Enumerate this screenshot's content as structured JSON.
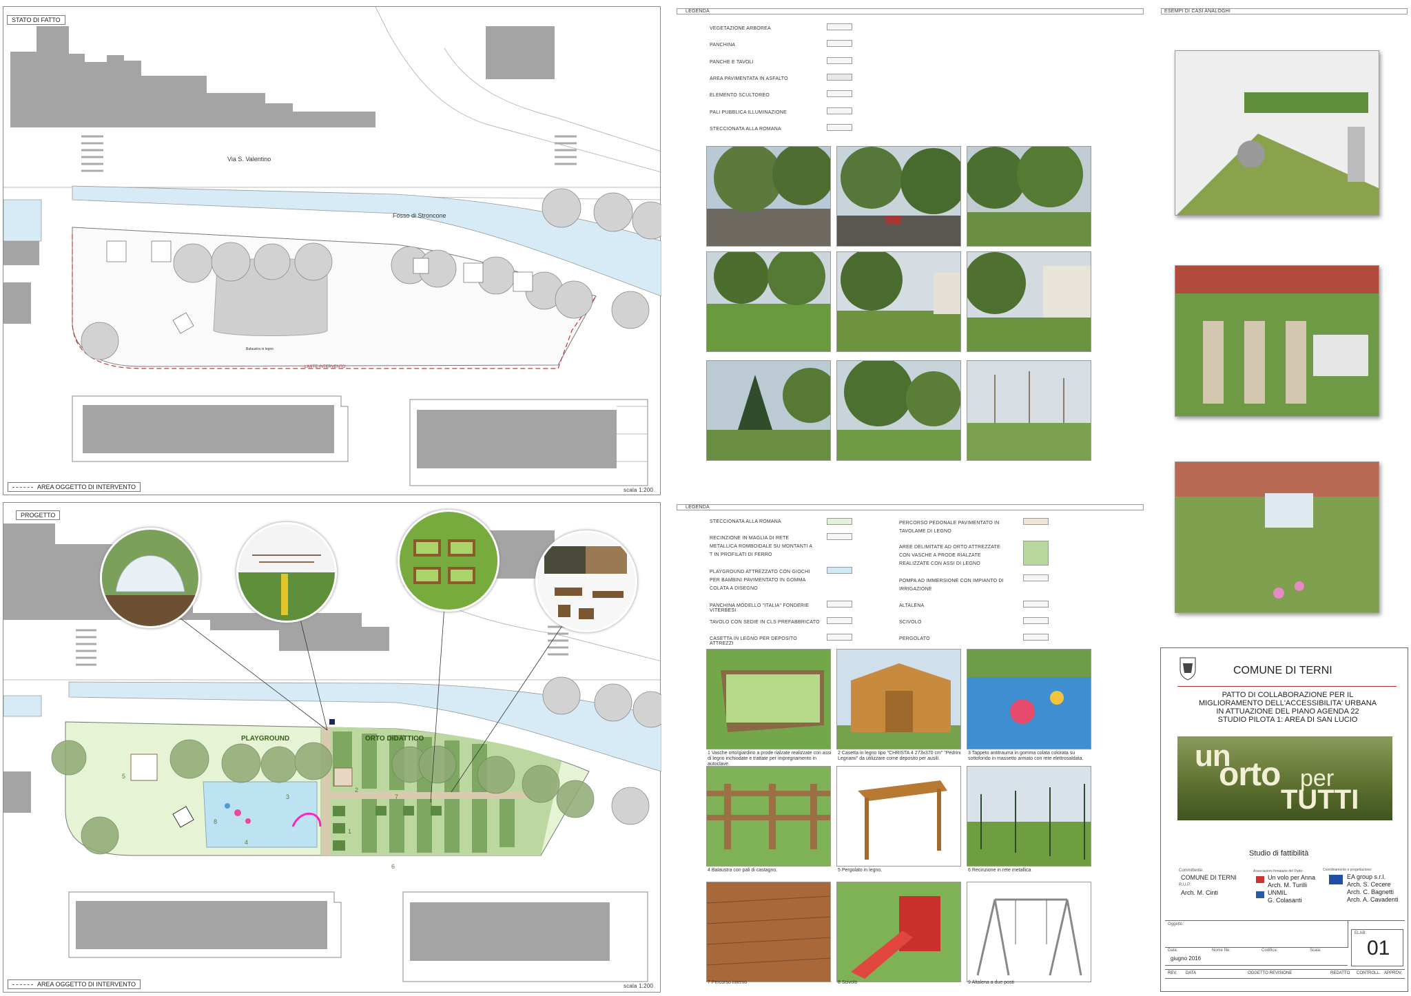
{
  "stato_di_fatto": {
    "title": "STATO DI FATTO",
    "street": "Via S. Valentino",
    "canal": "Fosso di Stronconе",
    "balaustra": "Balaustra in legno",
    "limite": "LIMITE INTERVENTO",
    "legend": "AREA OGGETTO DI INTERVENTO",
    "scale": "scala 1:200"
  },
  "progetto": {
    "title": "PROGETTO",
    "playground": "PLAYGROUND",
    "orto": "ORTO DIDATTICO",
    "legend": "AREA OGGETTO DI INTERVENTO",
    "scale": "scala 1:200",
    "numbers": [
      "1",
      "2",
      "3",
      "4",
      "5",
      "6",
      "7",
      "8"
    ]
  },
  "legenda_top": {
    "title": "LEGENDA",
    "items": [
      "VEGETAZIONE ARBOREA",
      "PANCHINA",
      "PANCHE E TAVOLI",
      "AREA PAVIMENTATA IN ASFALTO",
      "ELEMENTO SCULTOREO",
      "PALI PUBBLICA ILLUMINAZIONE",
      "STECCIONATA ALLA ROMANA"
    ]
  },
  "legenda_bottom": {
    "title": "LEGENDA",
    "left_items": [
      "STECCIONATA ALLA ROMANA",
      "RECINZIONE IN MAGLIA DI RETE METALLICA ROMBOIDALE SU MONTANTI A T IN PROFILATI DI FERRO",
      "PLAYGROUND ATTREZZATO CON GIOCHI PER BAMBINI PAVIMENTATO IN GOMMA COLATA A DISEGNO",
      "PANCHINA MODELLO \"ITALIA\" FONDERIE VITERBESI",
      "TAVOLO CON SEDIE IN CLS PREFABBRICATO",
      "CASETTA IN LEGNO PER DEPOSITO ATTREZZI"
    ],
    "right_items": [
      "PERCORSO PEDONALE PAVIMENTATO IN TAVOLAME DI LEGNO",
      "AREE DELIMITATE AD ORTO ATTREZZATE CON VASCHE A PRODE RIALZATE REALIZZATE CON ASSI DI LEGNO",
      "POMPA AD IMMERSIONE CON IMPIANTO DI IRRIGAZIONE",
      "ALTALENA",
      "SCIVOLO",
      "PERGOLATO"
    ]
  },
  "esempi": {
    "title": "ESEMPI DI CASI ANALOGHI"
  },
  "product_captions": [
    "1 Vasche orto/giardino a prode rialzate realizzate con assi di legno inchiodate e trattate per impregnamento in autoclave.",
    "2 Casetta in legno tipo \"CHRISTA 4 273x370 cm\" \"Pedrini Legnami\" da utilizzare come deposito per ausili.",
    "3 Tappeto antitrauma in gomma colata colorata su sottofondo in massetto armato con rete elettrosaldata.",
    "4 Balaustra con pali di castagno.",
    "5 Pergolato in legno.",
    "6 Recinzione in rete metallica",
    "7 Percorso interno",
    "8 Scivolo",
    "9 Altalena a due posti"
  ],
  "title_block": {
    "municipality": "COMUNE DI TERNI",
    "project_lines": [
      "PATTO DI COLLABORAZIONE PER IL",
      "MIGLIORAMENTO DELL'ACCESSIBILITA' URBANA",
      "IN ATTUAZIONE DEL PIANO AGENDA 22",
      "STUDIO PILOTA 1: AREA DI SAN LUCIO"
    ],
    "banner": {
      "w1": "un",
      "w2": "orto",
      "w3": "per",
      "w4": "TUTTI"
    },
    "study": "Studio di fattibilità",
    "committente_label": "Committente:",
    "committente": "COMUNE DI TERNI",
    "rup_label": "R.U.P.:",
    "rup": "Arch. M. Cinti",
    "associazioni_label": "Associazioni firmatarie del Patto:",
    "associazioni": [
      "Un volo per Anna",
      "Arch. M. Turilli",
      "UNMIL",
      "G. Colasanti"
    ],
    "coordinamento_label": "Coordinamento e progettazione:",
    "coordinamento": [
      "EA group s.r.l.",
      "Arch. S. Cecere",
      "Arch. C. Bagnetti",
      "Arch. A. Cavadenti"
    ],
    "oggetto_label": "Oggetto:",
    "elab_label": "ELAB:",
    "elab": "01",
    "data_label": "Data:",
    "data": "giugno 2016",
    "nome_file_label": "Nome file:",
    "codifica_label": "Codifica:",
    "scala_label": "Scala:",
    "rev_headers": [
      "REV.",
      "DATA",
      "OGGETTO REVISIONE",
      "REDATTO",
      "CONTROLL.",
      "APPROV."
    ]
  },
  "colors": {
    "building": "#a4a4a4",
    "canal": "#d6ebf5",
    "lawn": "#e6f3d4",
    "tree": "#c8c8c8",
    "limit": "#cc3333",
    "banner_green": "#5c6f2e"
  }
}
